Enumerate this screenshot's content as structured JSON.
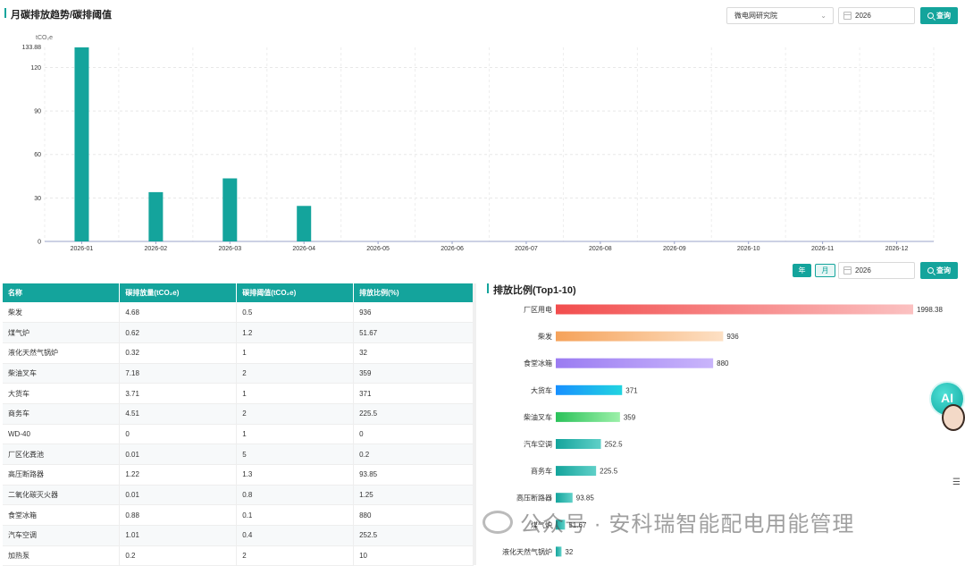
{
  "top": {
    "title": "月碳排放趋势/碳排阈值",
    "org_select": "微电网研究院",
    "year": "2026",
    "query_label": "查询",
    "unit": "tCO₂e",
    "max_label": "133.88"
  },
  "chart_data": [
    {
      "type": "bar",
      "title": "",
      "ylabel": "tCO₂e",
      "ylim": [
        0,
        150
      ],
      "yticks": [
        "0",
        "30",
        "60",
        "90",
        "120"
      ],
      "categories": [
        "2026-01",
        "2026-02",
        "2026-03",
        "2026-04",
        "2026-05",
        "2026-06",
        "2026-07",
        "2026-08",
        "2026-09",
        "2026-10",
        "2026-11",
        "2026-12"
      ],
      "values": [
        133.88,
        34,
        43.5,
        24.5,
        0,
        0,
        0,
        0,
        0,
        0,
        0,
        0
      ],
      "color": "#14a49c",
      "grid": true
    },
    {
      "type": "bar",
      "title": "排放比例(Top1-10)",
      "orientation": "horizontal",
      "categories": [
        "厂区用电",
        "柴发",
        "食堂冰箱",
        "大货车",
        "柴油叉车",
        "汽车空调",
        "商务车",
        "高压断路器",
        "煤气炉",
        "液化天然气锅炉"
      ],
      "values": [
        1998.38,
        936,
        880,
        371,
        359,
        252.5,
        225.5,
        93.85,
        51.67,
        32
      ],
      "labels": [
        "1998.38",
        "936",
        "880",
        "371",
        "359",
        "252.5",
        "225.5",
        "93.85",
        "51.67",
        "32"
      ],
      "colors": [
        [
          "#f24d4d",
          "#fbc1c1"
        ],
        [
          "#f5a25a",
          "#fde0c4"
        ],
        [
          "#9b7cf2",
          "#c9b5fb"
        ],
        [
          "#1890ff",
          "#21d4e0"
        ],
        [
          "#2bc25a",
          "#9cf0a9"
        ],
        [
          "#14a49c",
          "#5fd0c8"
        ],
        [
          "#14a49c",
          "#5fd0c8"
        ],
        [
          "#14a49c",
          "#5fd0c8"
        ],
        [
          "#14a49c",
          "#5fd0c8"
        ],
        [
          "#14a49c",
          "#5fd0c8"
        ]
      ]
    }
  ],
  "bottom": {
    "toggle_year": "年",
    "toggle_month": "月",
    "year": "2026",
    "query_label": "查询",
    "ratio_title": "排放比例(Top1-10)"
  },
  "table": {
    "headers": [
      "名称",
      "碳排放量(tCO₂e)",
      "碳排阈值(tCO₂e)",
      "排放比例(%)"
    ],
    "rows": [
      [
        "柴发",
        "4.68",
        "0.5",
        "936"
      ],
      [
        "煤气炉",
        "0.62",
        "1.2",
        "51.67"
      ],
      [
        "液化天然气锅炉",
        "0.32",
        "1",
        "32"
      ],
      [
        "柴油叉车",
        "7.18",
        "2",
        "359"
      ],
      [
        "大货车",
        "3.71",
        "1",
        "371"
      ],
      [
        "商务车",
        "4.51",
        "2",
        "225.5"
      ],
      [
        "WD-40",
        "0",
        "1",
        "0"
      ],
      [
        "厂区化粪池",
        "0.01",
        "5",
        "0.2"
      ],
      [
        "高压断路器",
        "1.22",
        "1.3",
        "93.85"
      ],
      [
        "二氧化碳灭火器",
        "0.01",
        "0.8",
        "1.25"
      ],
      [
        "食堂冰箱",
        "0.88",
        "0.1",
        "880"
      ],
      [
        "汽车空调",
        "1.01",
        "0.4",
        "252.5"
      ],
      [
        "加热泵",
        "0.2",
        "2",
        "10"
      ]
    ]
  },
  "widgets": {
    "ai_label": "AI",
    "watermark": "公众号 · 安科瑞智能配电用能管理"
  }
}
